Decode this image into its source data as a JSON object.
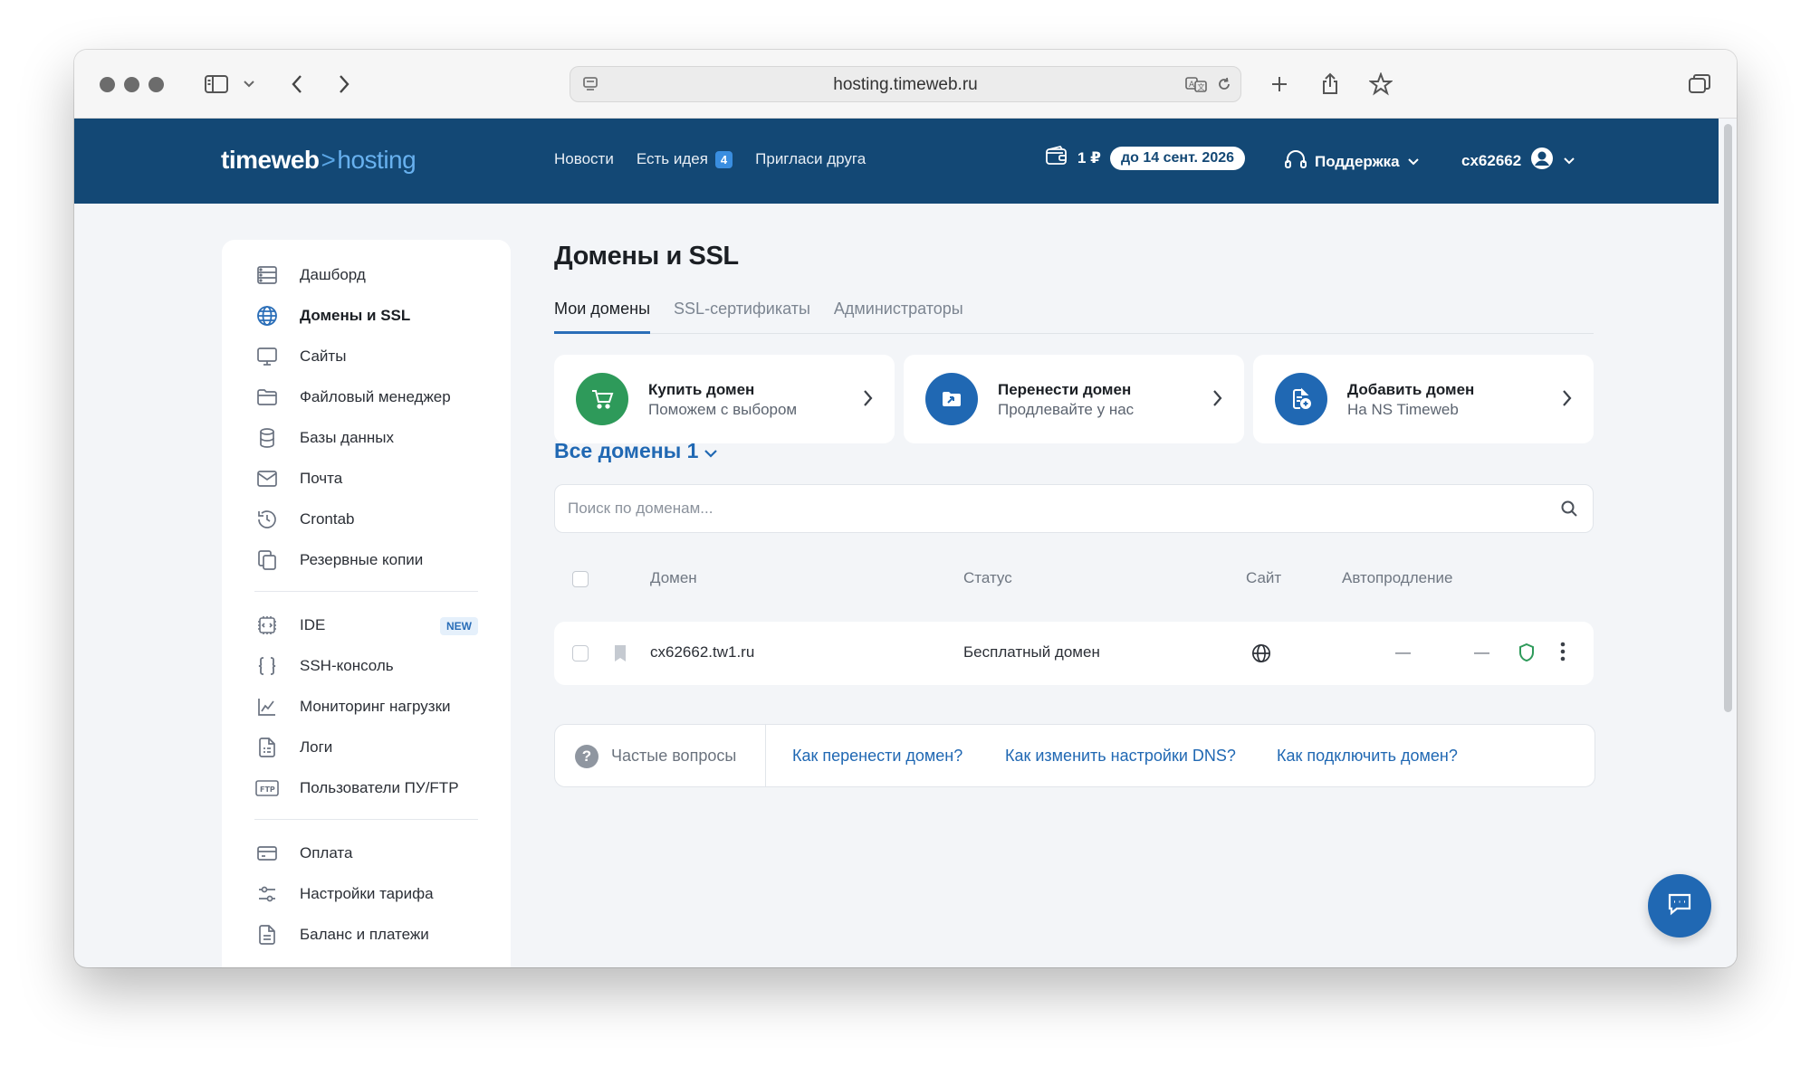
{
  "browser": {
    "url": "hosting.timeweb.ru"
  },
  "header": {
    "logo_part1": "timeweb",
    "logo_sep": ">",
    "logo_part2": "hosting",
    "nav": [
      {
        "label": "Новости"
      },
      {
        "label": "Есть идея",
        "badge": "4"
      },
      {
        "label": "Пригласи друга"
      }
    ],
    "balance": "1 ₽",
    "paid_until": "до 14 сент. 2026",
    "support": "Поддержка",
    "user": "cx62662"
  },
  "sidebar": {
    "groups": [
      [
        {
          "label": "Дашборд",
          "icon": "dashboard-icon"
        },
        {
          "label": "Домены и SSL",
          "icon": "globe-icon",
          "active": true
        },
        {
          "label": "Сайты",
          "icon": "monitor-icon"
        },
        {
          "label": "Файловый менеджер",
          "icon": "folder-icon"
        },
        {
          "label": "Базы данных",
          "icon": "database-icon"
        },
        {
          "label": "Почта",
          "icon": "mail-icon"
        },
        {
          "label": "Crontab",
          "icon": "history-icon"
        },
        {
          "label": "Резервные копии",
          "icon": "copy-icon"
        }
      ],
      [
        {
          "label": "IDE",
          "icon": "ide-icon",
          "badge": "NEW"
        },
        {
          "label": "SSH-консоль",
          "icon": "braces-icon"
        },
        {
          "label": "Мониторинг нагрузки",
          "icon": "chart-icon"
        },
        {
          "label": "Логи",
          "icon": "log-file-icon"
        },
        {
          "label": "Пользователи ПУ/FTP",
          "icon": "ftp-icon"
        }
      ],
      [
        {
          "label": "Оплата",
          "icon": "card-icon"
        },
        {
          "label": "Настройки тарифа",
          "icon": "sliders-icon"
        },
        {
          "label": "Баланс и платежи",
          "icon": "document-icon"
        }
      ]
    ]
  },
  "main": {
    "title": "Домены и SSL",
    "tabs": [
      {
        "label": "Мои домены",
        "active": true
      },
      {
        "label": "SSL-сертификаты"
      },
      {
        "label": "Администраторы"
      }
    ],
    "cards": [
      {
        "title": "Купить домен",
        "subtitle": "Поможем с выбором",
        "icon": "cart-icon",
        "color": "#2e9a5a"
      },
      {
        "title": "Перенести домен",
        "subtitle": "Продлевайте у нас",
        "icon": "transfer-folder-icon",
        "color": "#2068b3"
      },
      {
        "title": "Добавить домен",
        "subtitle": "На NS Timeweb",
        "icon": "add-domain-icon",
        "color": "#2068b3"
      }
    ],
    "all_domains": "Все домены 1",
    "search_placeholder": "Поиск по доменам...",
    "columns": [
      "Домен",
      "Статус",
      "Сайт",
      "Автопродление"
    ],
    "rows": [
      {
        "domain": "cx62662.tw1.ru",
        "status": "Бесплатный домен",
        "site": "globe-icon",
        "autorenew": "—",
        "extra": "—"
      }
    ],
    "faq": {
      "label": "Частые вопросы",
      "links": [
        "Как перенести домен?",
        "Как изменить настройки DNS?",
        "Как подключить домен?"
      ]
    }
  },
  "colors": {
    "header_bg": "#134875",
    "accent": "#2068b3",
    "green": "#2e9a5a"
  }
}
